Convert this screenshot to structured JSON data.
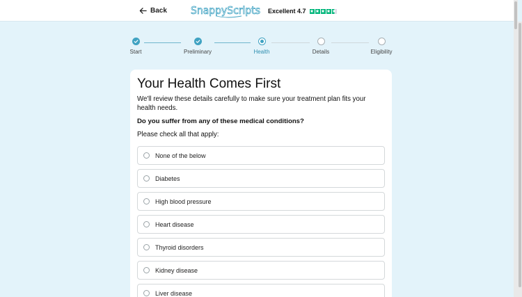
{
  "header": {
    "back_label": "Back",
    "brand_name": "SnappyScripts",
    "rating_label": "Excellent 4.7",
    "rating_stars": 4.5
  },
  "colors": {
    "accent": "#3fa2c2",
    "background": "#e3f3fa",
    "trust_green": "#00b67a"
  },
  "stepper": {
    "steps": [
      {
        "label": "Start",
        "state": "done"
      },
      {
        "label": "Preliminary",
        "state": "done"
      },
      {
        "label": "Health",
        "state": "current"
      },
      {
        "label": "Details",
        "state": "todo"
      },
      {
        "label": "Eligibility",
        "state": "todo"
      }
    ]
  },
  "card": {
    "title": "Your Health Comes First",
    "intro": "We'll review these details carefully to make sure your treatment plan fits your health needs.",
    "question": "Do you suffer from any of these medical conditions?",
    "instruction": "Please check all that apply:",
    "options": [
      "None of the below",
      "Diabetes",
      "High blood pressure",
      "Heart disease",
      "Thyroid disorders",
      "Kidney disease",
      "Liver disease"
    ]
  }
}
